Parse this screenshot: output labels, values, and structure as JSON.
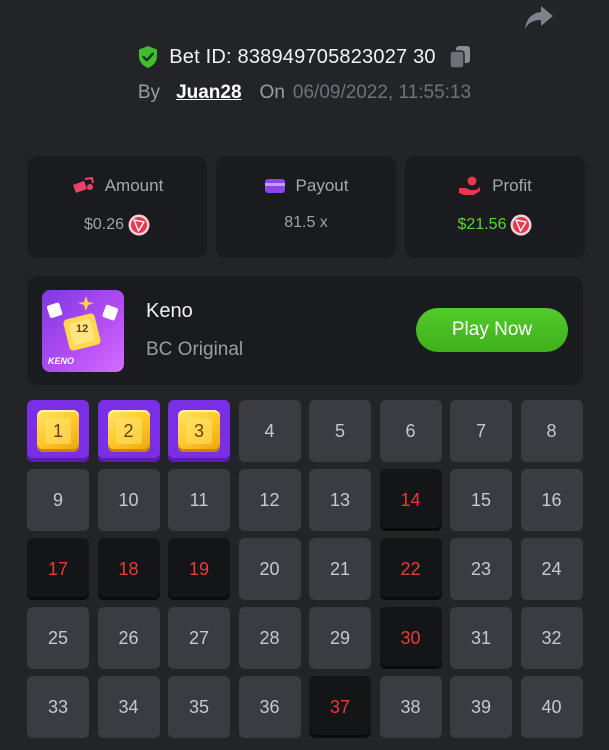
{
  "header": {
    "bet_id": "Bet ID: 838949705823027 30",
    "by_label": "By",
    "username": "Juan28",
    "on_label": "On",
    "datetime": "06/09/2022, 11:55:13"
  },
  "stats": {
    "amount": {
      "title": "Amount",
      "value": "$0.26"
    },
    "payout": {
      "title": "Payout",
      "value": "81.5 x"
    },
    "profit": {
      "title": "Profit",
      "value": "$21.56"
    }
  },
  "game": {
    "name": "Keno",
    "subtitle": "BC Original",
    "thumb_label": "KENO",
    "thumb_number": "12",
    "play_label": "Play Now"
  },
  "tiles": [
    {
      "n": "1",
      "state": "picked"
    },
    {
      "n": "2",
      "state": "picked"
    },
    {
      "n": "3",
      "state": "picked"
    },
    {
      "n": "4",
      "state": "normal"
    },
    {
      "n": "5",
      "state": "normal"
    },
    {
      "n": "6",
      "state": "normal"
    },
    {
      "n": "7",
      "state": "normal"
    },
    {
      "n": "8",
      "state": "normal"
    },
    {
      "n": "9",
      "state": "normal"
    },
    {
      "n": "10",
      "state": "normal"
    },
    {
      "n": "11",
      "state": "normal"
    },
    {
      "n": "12",
      "state": "normal"
    },
    {
      "n": "13",
      "state": "normal"
    },
    {
      "n": "14",
      "state": "hit"
    },
    {
      "n": "15",
      "state": "normal"
    },
    {
      "n": "16",
      "state": "normal"
    },
    {
      "n": "17",
      "state": "hit"
    },
    {
      "n": "18",
      "state": "hit"
    },
    {
      "n": "19",
      "state": "hit"
    },
    {
      "n": "20",
      "state": "normal"
    },
    {
      "n": "21",
      "state": "normal"
    },
    {
      "n": "22",
      "state": "hit"
    },
    {
      "n": "23",
      "state": "normal"
    },
    {
      "n": "24",
      "state": "normal"
    },
    {
      "n": "25",
      "state": "normal"
    },
    {
      "n": "26",
      "state": "normal"
    },
    {
      "n": "27",
      "state": "normal"
    },
    {
      "n": "28",
      "state": "normal"
    },
    {
      "n": "29",
      "state": "normal"
    },
    {
      "n": "30",
      "state": "hit"
    },
    {
      "n": "31",
      "state": "normal"
    },
    {
      "n": "32",
      "state": "normal"
    },
    {
      "n": "33",
      "state": "normal"
    },
    {
      "n": "34",
      "state": "normal"
    },
    {
      "n": "35",
      "state": "normal"
    },
    {
      "n": "36",
      "state": "normal"
    },
    {
      "n": "37",
      "state": "hit"
    },
    {
      "n": "38",
      "state": "normal"
    },
    {
      "n": "39",
      "state": "normal"
    },
    {
      "n": "40",
      "state": "normal"
    }
  ],
  "colors": {
    "background": "#232427",
    "card": "#1a1b1e",
    "tile": "#3a3c41",
    "hit_text": "#ea3a3a",
    "picked": "#7a2ee6",
    "play_button": "#4cbf24",
    "profit_green": "#5cd13c"
  }
}
